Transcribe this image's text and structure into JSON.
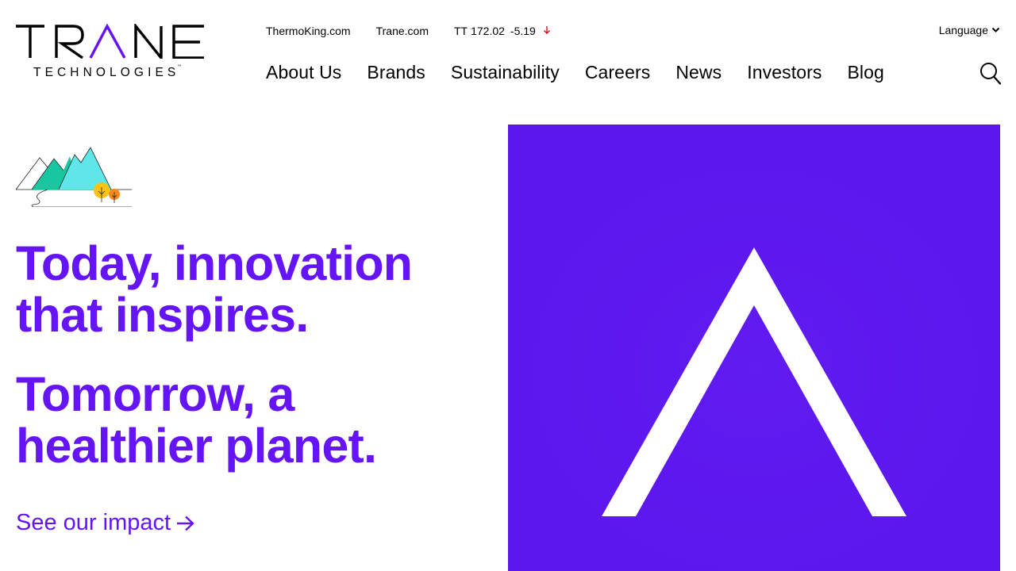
{
  "brand": {
    "name": "TRANE",
    "subtitle": "TECHNOLOGIES",
    "trademark": "™",
    "accent_color": "#6414f5",
    "hero_bg_color": "#5c17ee"
  },
  "utility_nav": {
    "links": [
      "ThermoKing.com",
      "Trane.com"
    ],
    "ticker": {
      "symbol": "TT",
      "price": "172.02",
      "change": "-5.19",
      "direction_icon": "arrow-down-icon"
    },
    "language_label": "Language"
  },
  "main_nav": {
    "items": [
      "About Us",
      "Brands",
      "Sustainability",
      "Careers",
      "News",
      "Investors",
      "Blog"
    ],
    "search_icon": "search-icon"
  },
  "hero": {
    "headline_1": "Today, innovation that inspires.",
    "headline_2": "Tomorrow, a healthier planet.",
    "cta_label": "See our impact",
    "illustration": "mountains-illustration",
    "media_icon": "trane-chevron-icon"
  }
}
